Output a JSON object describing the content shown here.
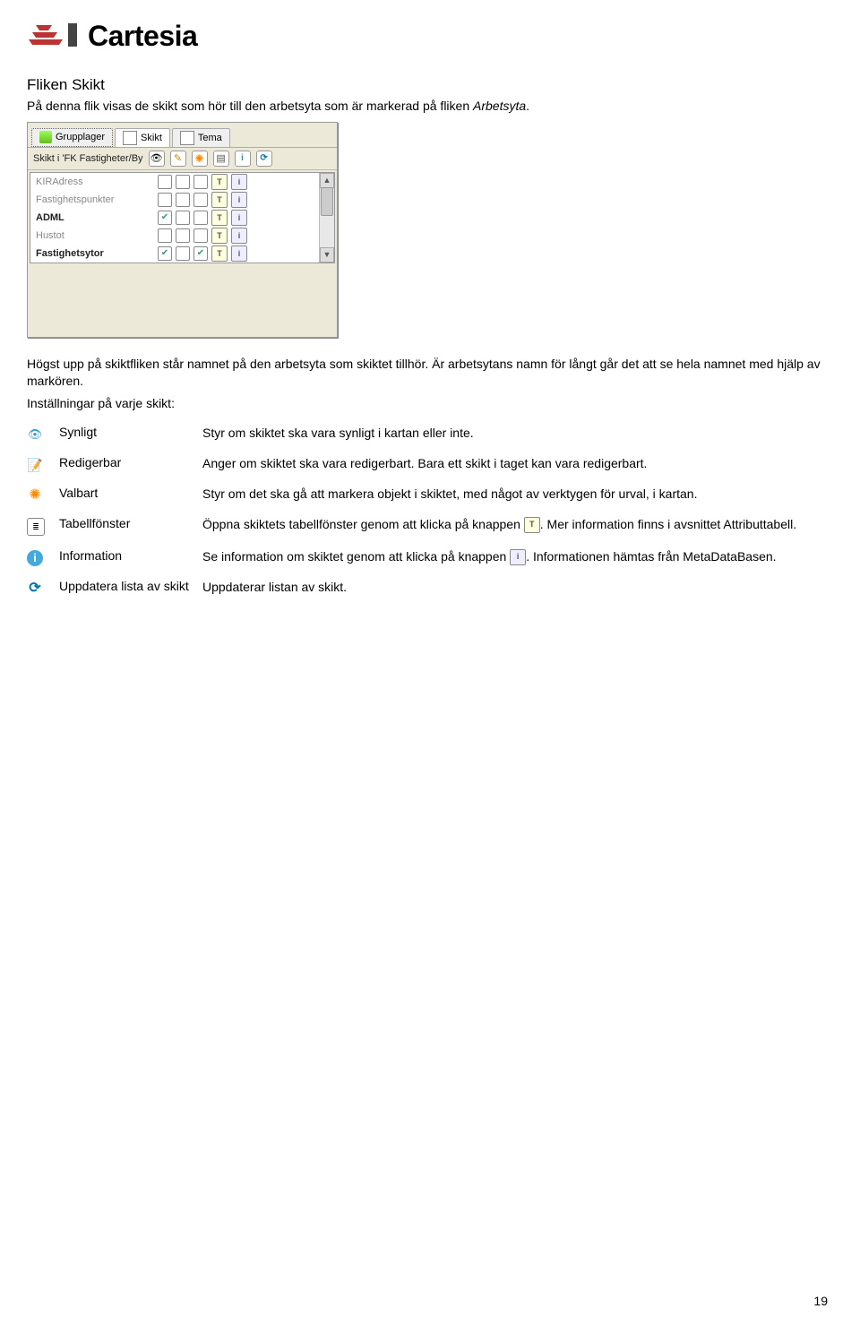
{
  "brand": {
    "name": "Cartesia"
  },
  "title": "Fliken Skikt",
  "intro_before_italic": "På denna flik visas de skikt som hör till den arbetsyta som är markerad på fliken ",
  "intro_italic": "Arbetsyta",
  "intro_period": ".",
  "panel": {
    "tabs": [
      {
        "label": "Grupplager"
      },
      {
        "label": "Skikt"
      },
      {
        "label": "Tema"
      }
    ],
    "toolbar_label": "Skikt i 'FK Fastigheter/By",
    "rows": [
      {
        "name": "KIRAdress",
        "kind": "gray",
        "c1": false,
        "c2": false,
        "c3": false
      },
      {
        "name": "Fastighetspunkter",
        "kind": "gray",
        "c1": false,
        "c2": false,
        "c3": false
      },
      {
        "name": "ADML",
        "kind": "bold",
        "c1": true,
        "c2": false,
        "c3": false
      },
      {
        "name": "Hustot",
        "kind": "gray",
        "c1": false,
        "c2": false,
        "c3": false
      },
      {
        "name": "Fastighetsytor",
        "kind": "bold",
        "c1": true,
        "c2": false,
        "c3": true
      }
    ]
  },
  "after": {
    "p1": "Högst upp på skiktfliken står namnet på den arbetsyta som skiktet tillhör. Är arbetsytans namn för långt går det att se hela namnet med hjälp av markören.",
    "p2": "Inställningar på varje skikt:"
  },
  "settings": [
    {
      "icon": "s-eye",
      "label": "Synligt",
      "desc": "Styr om skiktet ska vara synligt i kartan eller inte."
    },
    {
      "icon": "s-pencil",
      "label": "Redigerbar",
      "desc": "Anger om skiktet ska vara redigerbart. Bara ett skikt i taget kan vara redigerbart."
    },
    {
      "icon": "s-star",
      "label": "Valbart",
      "desc": "Styr om det ska gå att markera objekt i skiktet, med något av verktygen för urval, i kartan."
    },
    {
      "icon": "s-list",
      "label": "Tabellfönster",
      "desc_pre": "Öppna skiktets tabellfönster genom att klicka på knappen ",
      "desc_post": ". Mer information finns i avsnittet Attributtabell.",
      "inline_icon": "t"
    },
    {
      "icon": "s-info",
      "label": "Information",
      "desc_pre": "Se information om skiktet genom att klicka på knappen ",
      "desc_post": ". Informationen hämtas från MetaDataBasen.",
      "inline_icon": "i"
    },
    {
      "icon": "s-refresh",
      "label": "Uppdatera lista av skikt",
      "desc": "Uppdaterar listan av skikt."
    }
  ],
  "page_number": "19"
}
